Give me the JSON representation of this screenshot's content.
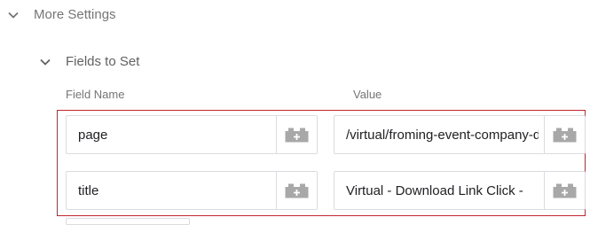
{
  "more_settings": {
    "label": "More Settings",
    "expanded": true
  },
  "fields_to_set": {
    "label": "Fields to Set",
    "expanded": true,
    "columns": {
      "name": "Field Name",
      "value": "Value"
    },
    "rows": [
      {
        "name": "page",
        "value": "/virtual/froming-event-company-download"
      },
      {
        "name": "title",
        "value": "Virtual - Download Link Click - "
      }
    ]
  },
  "icons": {
    "expand": "chevron-down-icon",
    "variable": "add-variable-brick-icon"
  },
  "colors": {
    "highlight_border": "#c0262d",
    "field_border": "#dadce0",
    "icon": "#a8a8a8"
  }
}
